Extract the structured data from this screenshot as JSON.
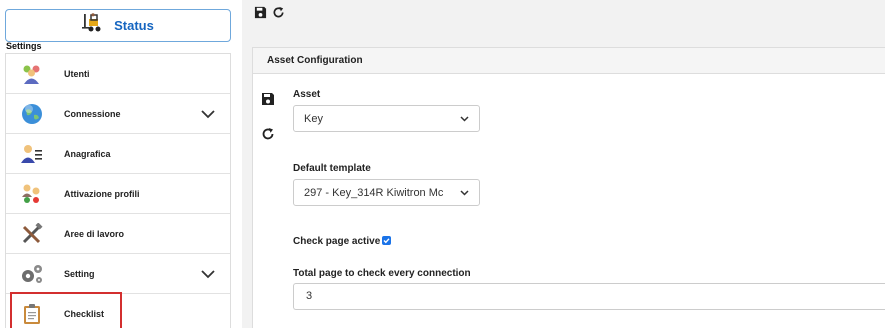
{
  "sidebar": {
    "status_label": "Status",
    "settings_label": "Settings",
    "items": [
      {
        "label": "Utenti",
        "icon": "users-icon"
      },
      {
        "label": "Connessione",
        "icon": "globe-icon"
      },
      {
        "label": "Anagrafica",
        "icon": "user-card-icon"
      },
      {
        "label": "Attivazione profili",
        "icon": "profiles-icon"
      },
      {
        "label": "Aree di lavoro",
        "icon": "tools-icon"
      },
      {
        "label": "Setting",
        "icon": "gears-icon"
      },
      {
        "label": "Checklist",
        "icon": "clipboard-icon"
      }
    ]
  },
  "panel": {
    "title": "Asset Configuration",
    "asset_label": "Asset",
    "asset_value": "Key",
    "template_label": "Default template",
    "template_value": "297 - Key_314R Kiwitron Mc",
    "check_label": "Check page active",
    "check_value": true,
    "total_label": "Total page to check every connection",
    "total_value": "3"
  },
  "colors": {
    "accent": "#1565c0",
    "highlight": "#d32f2f",
    "checkbox": "#1a73e8"
  }
}
